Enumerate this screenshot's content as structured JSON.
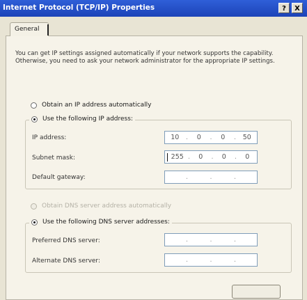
{
  "window": {
    "title": "Internet Protocol (TCP/IP) Properties",
    "help_button": "?",
    "close_button": "X"
  },
  "tabs": [
    {
      "label": "General",
      "active": true
    }
  ],
  "intro_text": "You can get IP settings assigned automatically if your network supports the capability. Otherwise, you need to ask your network administrator for the appropriate IP settings.",
  "ip_mode": {
    "auto_label": "Obtain an IP address automatically",
    "manual_label": "Use the following IP address:",
    "selected": "manual"
  },
  "ip_fields": [
    {
      "label": "IP address:",
      "octets": [
        "10",
        "0",
        "0",
        "50"
      ]
    },
    {
      "label": "Subnet mask:",
      "octets": [
        "255",
        "0",
        "0",
        "0"
      ],
      "focused": true
    },
    {
      "label": "Default gateway:",
      "octets": [
        "",
        "",
        "",
        ""
      ]
    }
  ],
  "dns_mode": {
    "auto_label": "Obtain DNS server address automatically",
    "auto_enabled": false,
    "manual_label": "Use the following DNS server addresses:",
    "selected": "manual"
  },
  "dns_fields": [
    {
      "label": "Preferred DNS server:",
      "octets": [
        "",
        "",
        "",
        ""
      ]
    },
    {
      "label": "Alternate DNS server:",
      "octets": [
        "",
        "",
        "",
        ""
      ]
    }
  ]
}
